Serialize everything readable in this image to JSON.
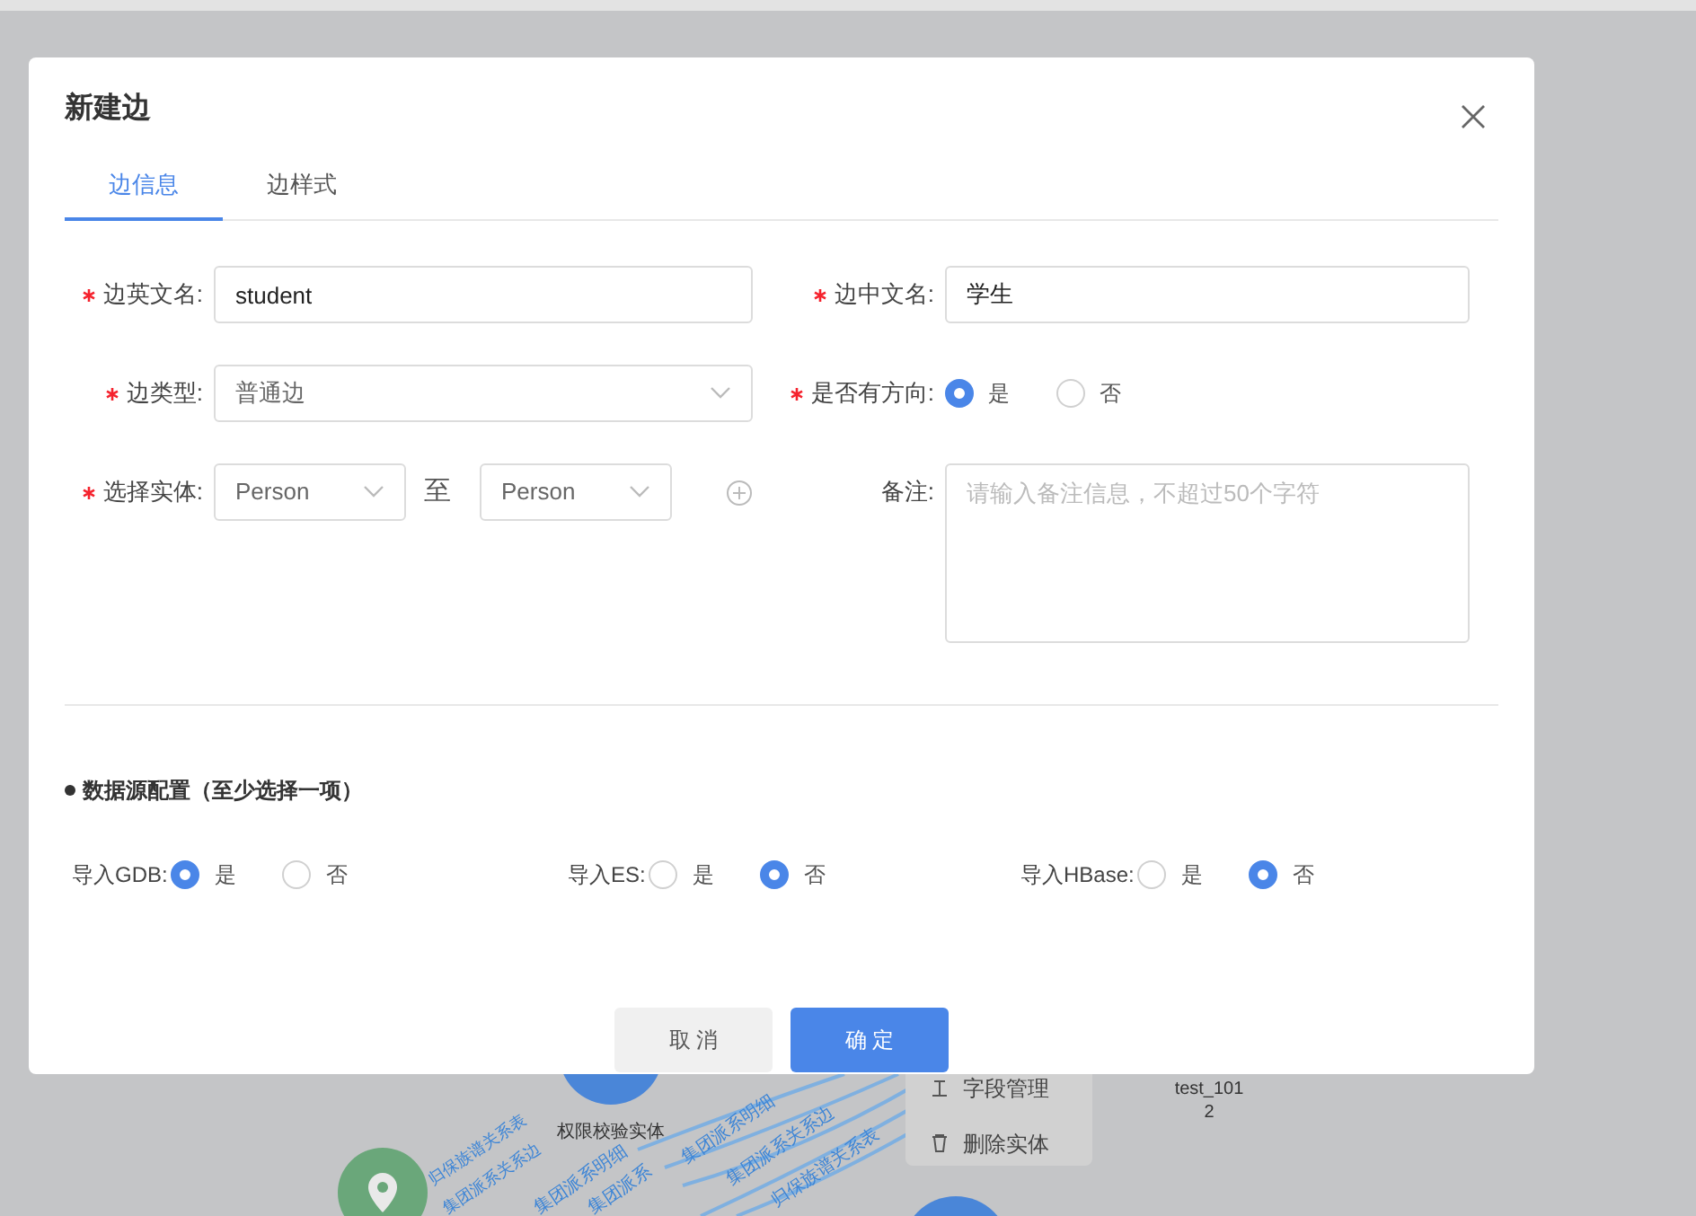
{
  "dialog": {
    "title": "新建边",
    "tabs": [
      {
        "label": "边信息",
        "selected": true
      },
      {
        "label": "边样式",
        "selected": false
      }
    ],
    "fields": [
      {
        "kind": "text",
        "label": "边英文名:",
        "required": true,
        "value": "student"
      },
      {
        "kind": "text",
        "label": "边中文名:",
        "required": true,
        "value": "学生"
      },
      {
        "kind": "select",
        "label": "边类型:",
        "required": true,
        "value": "普通边"
      },
      {
        "kind": "radio",
        "label": "是否有方向:",
        "required": true,
        "options": [
          {
            "label": "是",
            "selected": true
          },
          {
            "label": "否",
            "selected": false
          }
        ]
      },
      {
        "kind": "entity",
        "label": "选择实体:",
        "required": true,
        "from": "Person",
        "joiner": "至",
        "to": "Person"
      },
      {
        "kind": "textarea",
        "label": "备注:",
        "required": false,
        "placeholder": "请输入备注信息，不超过50个字符"
      }
    ],
    "section_title": "数据源配置（至少选择一项）",
    "datasources": [
      {
        "label": "导入GDB:",
        "options": [
          {
            "label": "是",
            "selected": true
          },
          {
            "label": "否",
            "selected": false
          }
        ]
      },
      {
        "label": "导入ES:",
        "options": [
          {
            "label": "是",
            "selected": false
          },
          {
            "label": "否",
            "selected": true
          }
        ]
      },
      {
        "label": "导入HBase:",
        "options": [
          {
            "label": "是",
            "selected": false
          },
          {
            "label": "否",
            "selected": true
          }
        ]
      }
    ],
    "buttons": [
      {
        "label": "取 消",
        "kind": "secondary"
      },
      {
        "label": "确 定",
        "kind": "primary"
      }
    ]
  },
  "background": {
    "node_label": "权限校验实体",
    "node_label_2": [
      "test_101",
      "2"
    ],
    "menu_items": [
      {
        "label": "字段管理",
        "kind": "fields"
      },
      {
        "label": "删除实体",
        "kind": "delete"
      }
    ],
    "edge_labels": [
      "集团派系明细",
      "集团派系关系边",
      "归保族谱关系表",
      "归保族谱关系表",
      "集团派系关系边",
      "集团派系明细",
      "集团派系"
    ]
  }
}
